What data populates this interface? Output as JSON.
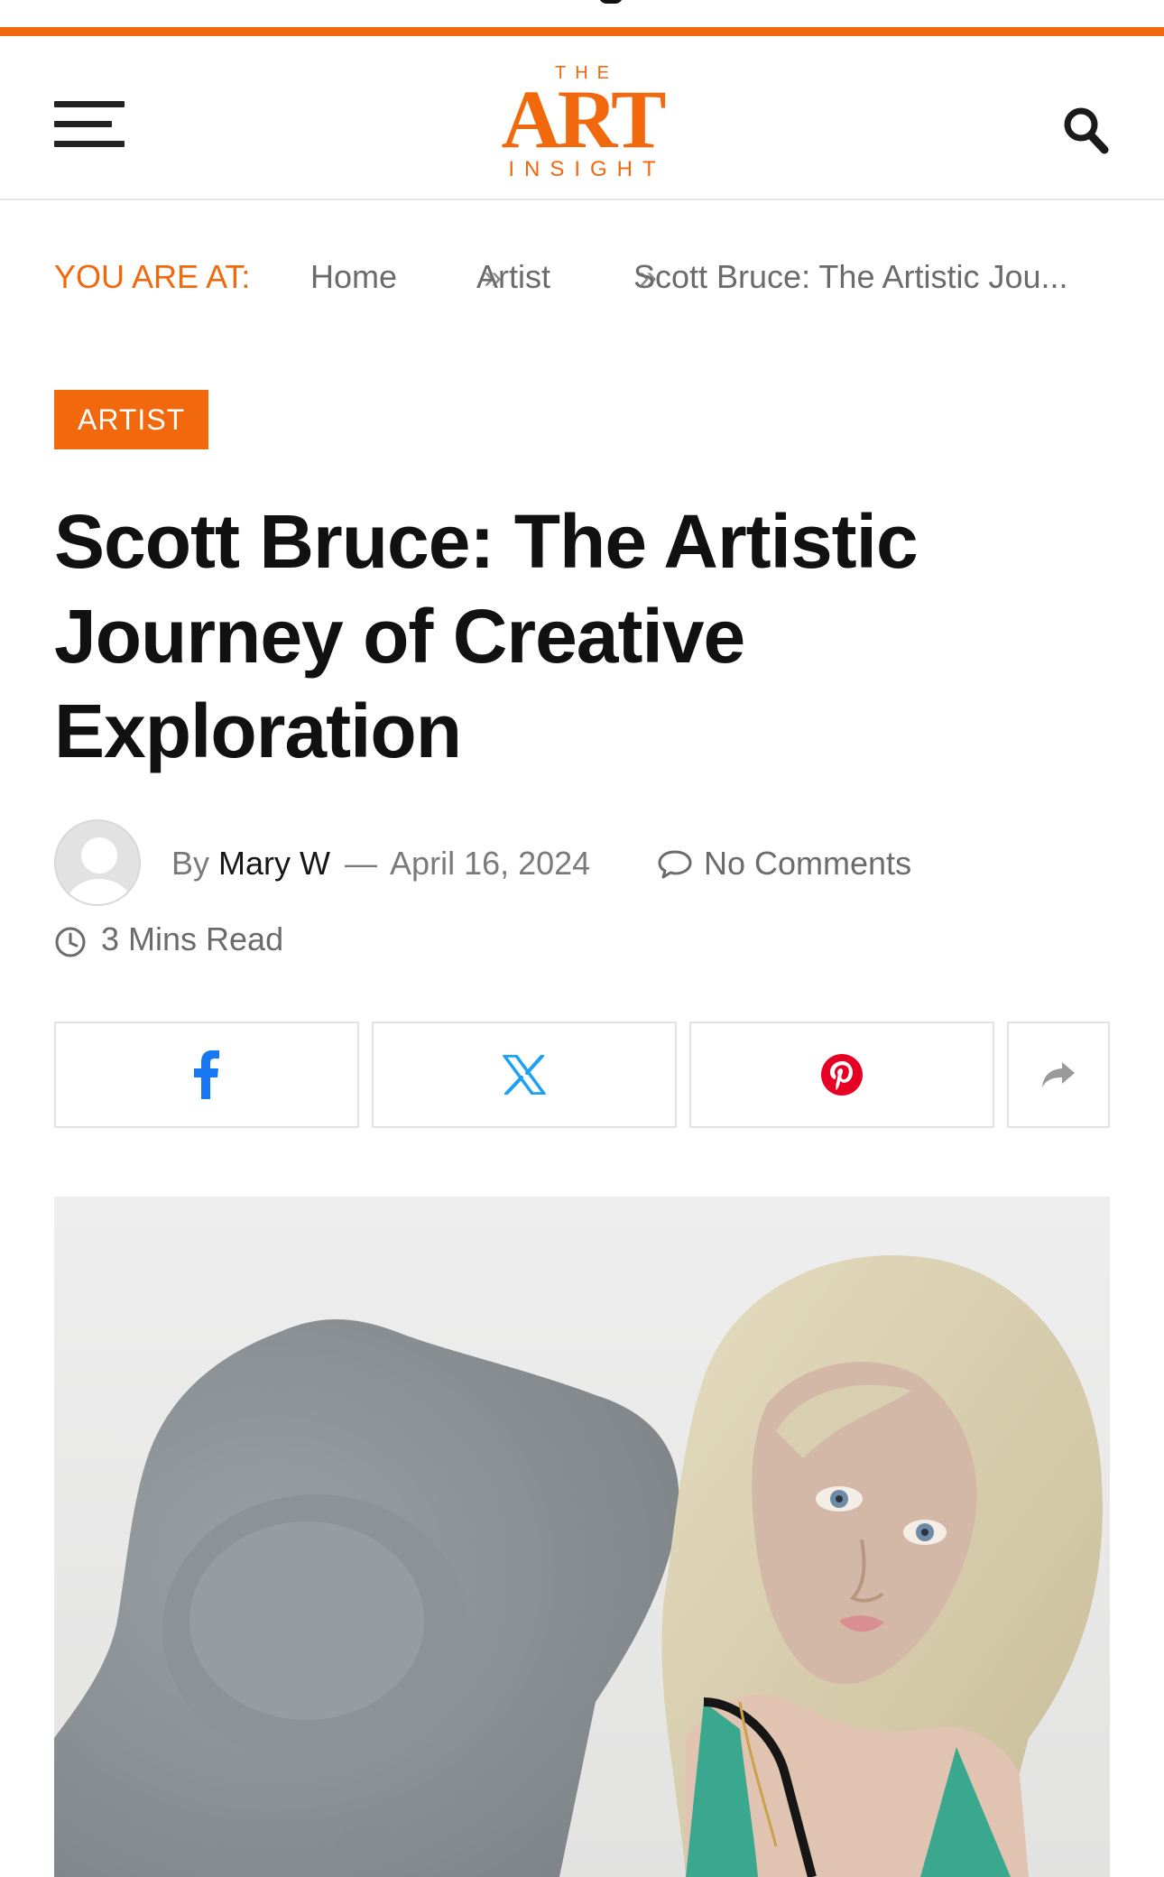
{
  "colors": {
    "accent": "#f2690d",
    "text_dark": "#161616",
    "text_muted": "#6b6b6b",
    "facebook": "#1877f2",
    "x_twitter": "#1da1f2",
    "pinterest": "#e60023",
    "share_gray": "#9a9a9a"
  },
  "header": {
    "menu_icon": "hamburger-menu-icon",
    "logo": {
      "top": "THE",
      "main": "ART",
      "bottom": "INSIGHT"
    },
    "search_icon": "search-icon"
  },
  "breadcrumb": {
    "prefix": "YOU ARE AT:",
    "items": [
      "Home",
      "Artist",
      "Scott Bruce: The Artistic Jou..."
    ],
    "separator": "»"
  },
  "post": {
    "category": "ARTIST",
    "title": "Scott Bruce: The Artistic Journey of Creative Exploration",
    "by_label": "By",
    "author": "Mary W",
    "dash": "—",
    "date": "April 16, 2024",
    "comments": "No Comments",
    "read_time": "3 Mins Read"
  },
  "share": {
    "buttons": [
      {
        "icon": "facebook-icon"
      },
      {
        "icon": "x-twitter-icon"
      },
      {
        "icon": "pinterest-icon"
      },
      {
        "icon": "share-arrow-icon"
      }
    ]
  },
  "hero_image": {
    "subject": "sculpture-photo"
  }
}
